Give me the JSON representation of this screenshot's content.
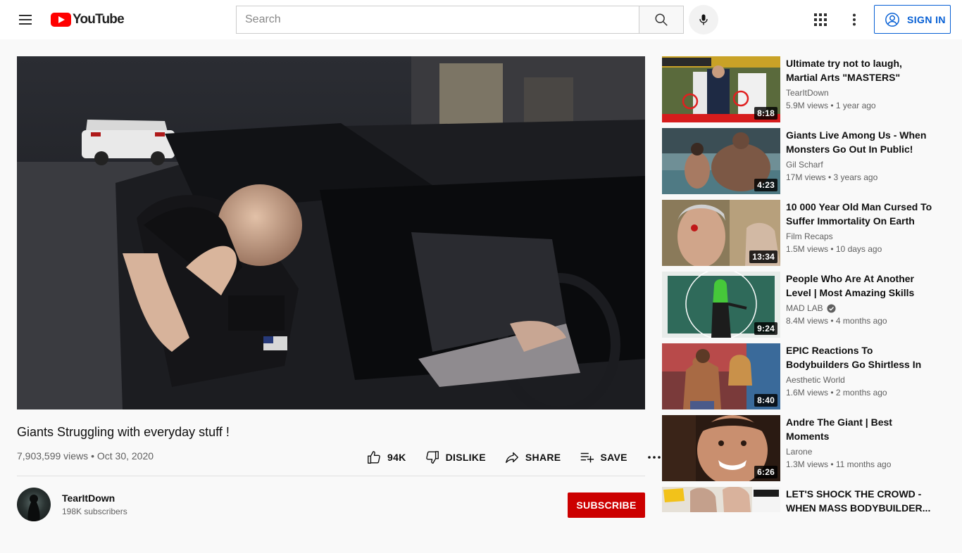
{
  "header": {
    "logo_text": "YouTube",
    "search_placeholder": "Search",
    "signin_label": "SIGN IN"
  },
  "video": {
    "title": "Giants Struggling with everyday stuff !",
    "views": "7,903,599 views",
    "date": "Oct 30, 2020",
    "likes": "94K",
    "dislike_label": "DISLIKE",
    "share_label": "SHARE",
    "save_label": "SAVE"
  },
  "channel": {
    "name": "TearItDown",
    "subscribers": "198K subscribers",
    "subscribe_label": "SUBSCRIBE"
  },
  "recommendations": [
    {
      "title": "Ultimate try not to laugh, Martial Arts \"MASTERS\" edition",
      "channel": "TearItDown",
      "stats": "5.9M views • 1 year ago",
      "duration": "8:18",
      "verified": false
    },
    {
      "title": "Giants Live Among Us - When Monsters Go Out In Public!",
      "channel": "Gil Scharf",
      "stats": "17M views • 3 years ago",
      "duration": "4:23",
      "verified": false
    },
    {
      "title": "10 000 Year Old Man Cursed To Suffer Immortality On Earth",
      "channel": "Film Recaps",
      "stats": "1.5M views • 10 days ago",
      "duration": "13:34",
      "verified": false
    },
    {
      "title": "People Who Are At Another Level | Most Amazing Skills An...",
      "channel": "MAD LAB",
      "stats": "8.4M views • 4 months ago",
      "duration": "9:24",
      "verified": true
    },
    {
      "title": "EPIC Reactions To Bodybuilders Go Shirtless In Public 😱",
      "channel": "Aesthetic World",
      "stats": "1.6M views • 2 months ago",
      "duration": "8:40",
      "verified": false
    },
    {
      "title": "Andre The Giant | Best Moments",
      "channel": "Larone",
      "stats": "1.3M views • 11 months ago",
      "duration": "6:26",
      "verified": false
    },
    {
      "title": "LET'S SHOCK THE CROWD - WHEN MASS BODYBUILDER...",
      "channel": "",
      "stats": "",
      "duration": "",
      "verified": false
    }
  ]
}
